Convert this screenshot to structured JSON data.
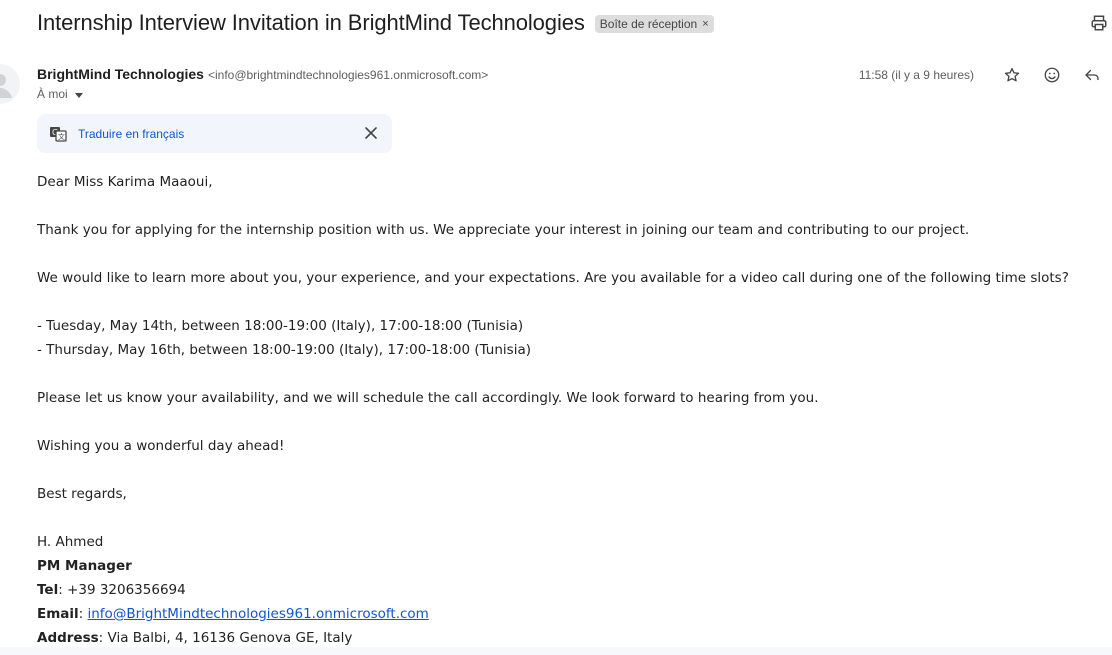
{
  "email": {
    "subject": "Internship Interview Invitation in BrightMind Technologies",
    "label": "Boîte de réception",
    "label_remove": "×",
    "sender_name": "BrightMind Technologies",
    "sender_email": "<info@brightmindtechnologies961.onmicrosoft.com>",
    "recipient": "À moi",
    "timestamp": "11:58 (il y a 9 heures)",
    "translate_link": "Traduire en français"
  },
  "icons": {
    "print": "printer-icon",
    "star": "star-icon",
    "emoji": "emoji-icon",
    "reply": "reply-icon",
    "translate": "translate-icon",
    "close": "close-icon",
    "avatar": "person-avatar-icon"
  },
  "body": {
    "greeting": "Dear Miss Karima Maaoui,",
    "para1": "Thank you for applying for the internship position with us. We appreciate your interest in joining our team and contributing to our project.",
    "para2": "We would like to learn more about you, your experience, and your expectations. Are you available for a video call during one of the following time slots?",
    "slot1": "- Tuesday, May 14th, between 18:00-19:00 (Italy), 17:00-18:00 (Tunisia)",
    "slot2": "- Thursday, May 16th, between 18:00-19:00 (Italy), 17:00-18:00 (Tunisia)",
    "para3": "Please let us know your availability, and we will schedule the call accordingly. We look forward to hearing from you.",
    "para4": "Wishing you a wonderful day ahead!",
    "closing": "Best regards,",
    "signature_name": "H. Ahmed",
    "signature_title": "PM Manager",
    "tel_label": "Tel",
    "tel_value": ": +39 3206356694",
    "email_label": "Email",
    "email_sep": ": ",
    "email_value": "info@BrightMindtechnologies961.onmicrosoft.com",
    "address_label": "Address",
    "address_value": ": Via Balbi, 4, 16136 Genova GE, Italy"
  },
  "colors": {
    "link": "#0b57d0",
    "body_link": "#1155cc",
    "label_chip_bg": "#dddddd",
    "translate_bar_bg": "#f2f6fc"
  }
}
